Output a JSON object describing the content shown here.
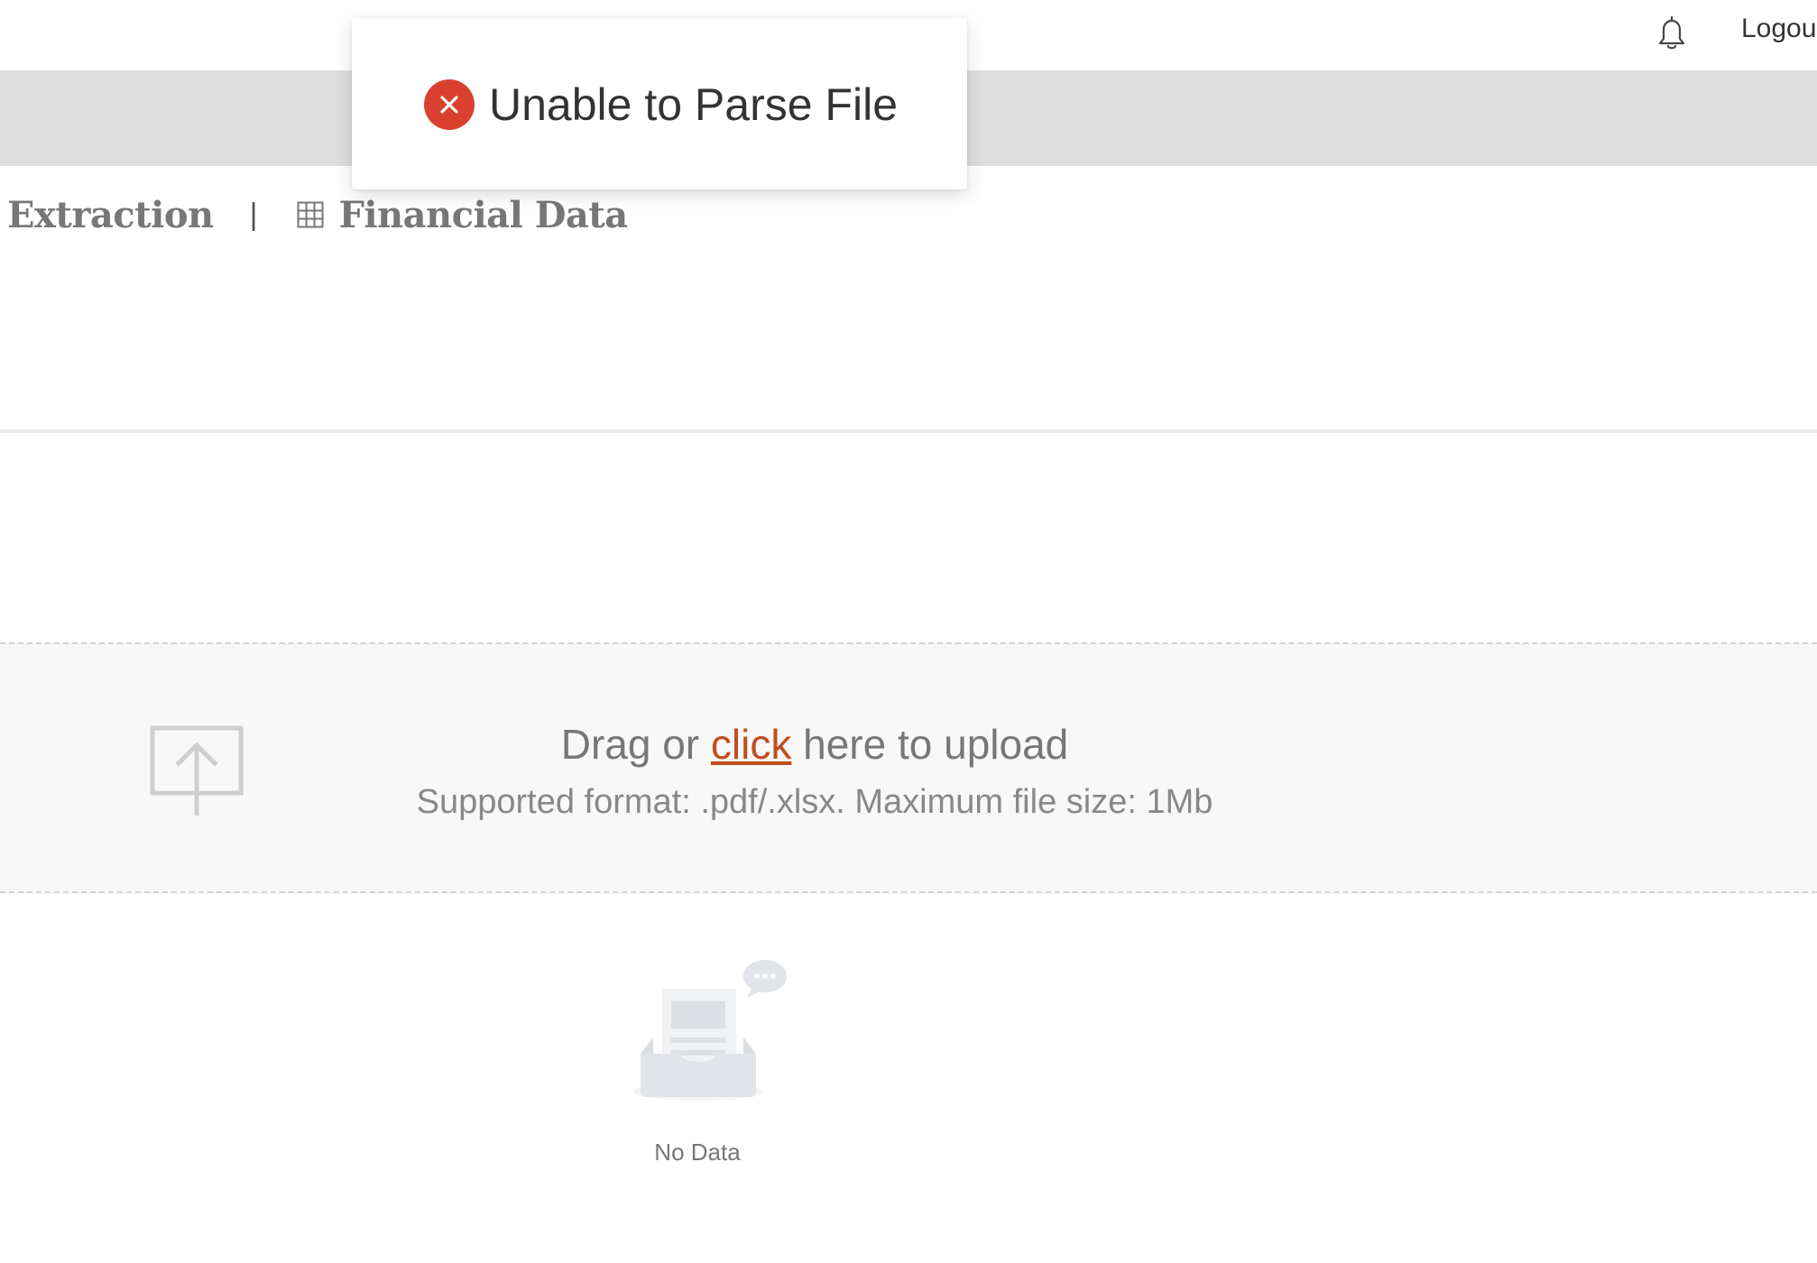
{
  "header": {
    "logout_label": "Logou"
  },
  "breadcrumb": {
    "extraction_label": "Extraction",
    "separator": "|",
    "financial_data_label": "Financial Data"
  },
  "upload": {
    "prefix": "Drag or ",
    "link_text": "click",
    "suffix": " here to upload",
    "hint": "Supported format: .pdf/.xlsx. Maximum file size: 1Mb"
  },
  "empty_state": {
    "label": "No Data"
  },
  "toast": {
    "message": "Unable to Parse File",
    "icon": "error-circle-icon"
  },
  "colors": {
    "error": "#d9412e",
    "link": "#c24d1e",
    "band": "#dedede",
    "upload_bg": "#f8f8f8"
  }
}
